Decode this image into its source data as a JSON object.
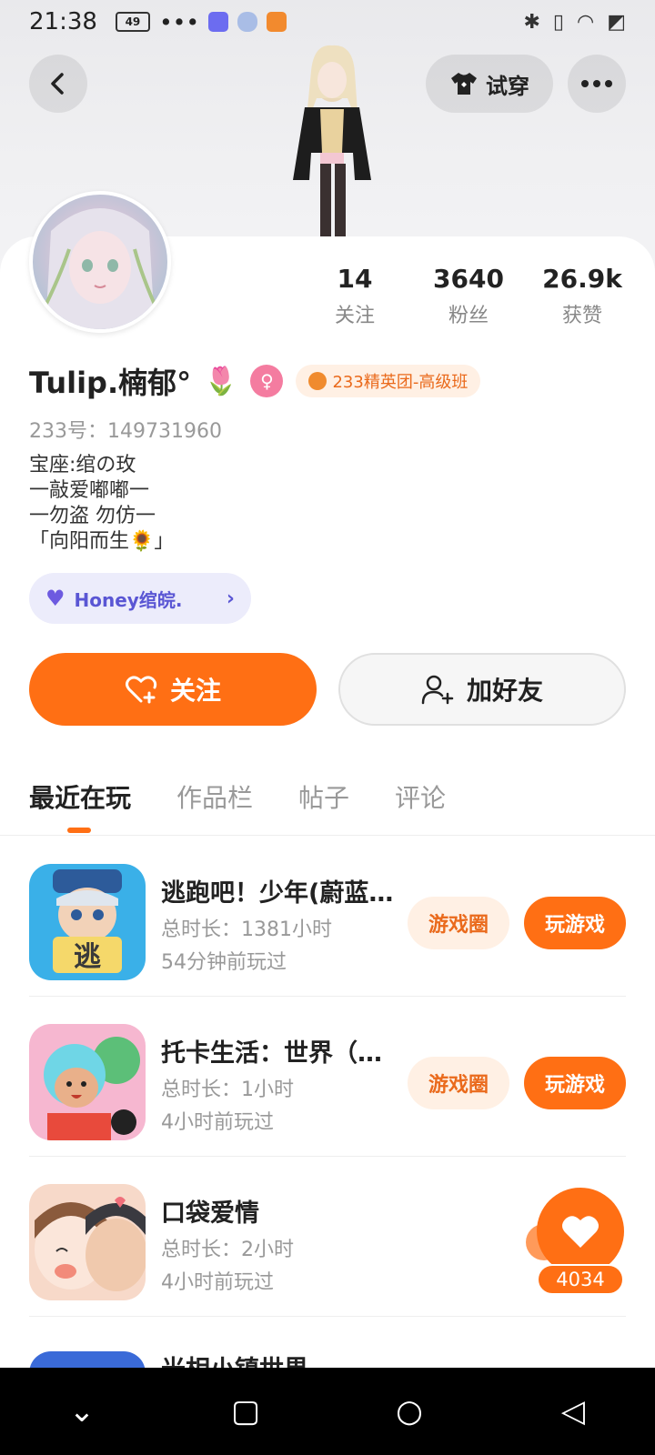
{
  "status_bar": {
    "time": "21:38",
    "battery": "49",
    "icons": [
      "more-dots-icon",
      "game-icon",
      "cloud-icon",
      "app-icon",
      "bluetooth-icon",
      "vibrate-icon",
      "wifi-icon",
      "sim-off-icon"
    ]
  },
  "header": {
    "tryon_label": "试穿"
  },
  "stats": [
    {
      "value": "14",
      "label": "关注"
    },
    {
      "value": "3640",
      "label": "粉丝"
    },
    {
      "value": "26.9k",
      "label": "获赞"
    }
  ],
  "profile": {
    "name": "Tulip.楠郁°",
    "team_badge": "233精英团-高级班",
    "uid": "233号：149731960",
    "bio": [
      "宝座:绾の玫",
      "一敲爱嘟嘟一",
      "一勿盗 勿仿一",
      "「向阳而生🌻」"
    ],
    "honey_chip": "Honey绾皖."
  },
  "actions": {
    "follow": "关注",
    "add_friend": "加好友"
  },
  "tabs": [
    {
      "label": "最近在玩",
      "active": true
    },
    {
      "label": "作品栏",
      "active": false
    },
    {
      "label": "帖子",
      "active": false
    },
    {
      "label": "评论",
      "active": false
    }
  ],
  "games": [
    {
      "title": "逃跑吧！少年(蔚蓝…",
      "duration": "总时长：1381小时",
      "last_played": "54分钟前玩过",
      "circle_label": "游戏圈",
      "play_label": "玩游戏"
    },
    {
      "title": "托卡生活：世界（…",
      "duration": "总时长：1小时",
      "last_played": "4小时前玩过",
      "circle_label": "游戏圈",
      "play_label": "玩游戏"
    },
    {
      "title": "口袋爱情",
      "duration": "总时长：2小时",
      "last_played": "4小时前玩过"
    }
  ],
  "partial_game_title": "光相小镇世界",
  "like_fab": {
    "count": "4034"
  },
  "colors": {
    "accent": "#ff6f14",
    "badge_bg": "#fff0e4",
    "honey_chip_bg": "#ececfb"
  }
}
